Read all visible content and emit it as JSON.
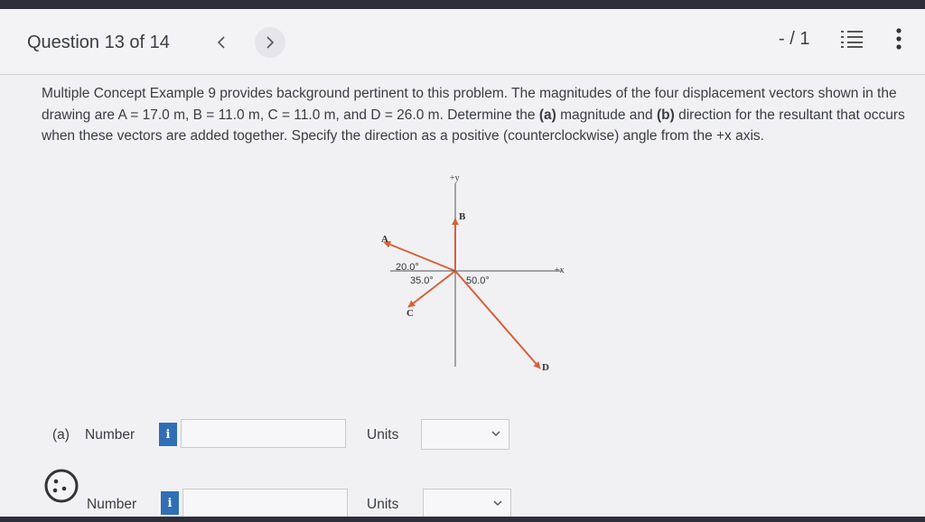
{
  "header": {
    "question_title": "Question 13 of 14",
    "prev_icon": "chevron-left-icon",
    "next_icon": "chevron-right-icon",
    "score": "- / 1",
    "list_icon": "list-icon",
    "more_icon": "more-vertical-icon"
  },
  "question": {
    "p1": "Multiple Concept Example 9 provides background pertinent to this problem. The magnitudes of the four displacement vectors shown in the drawing are ",
    "a_eq": "A = 17.0 m, B = 11.0 m, C = 11.0 m, and D = 26.0 m",
    "p2": ". Determine the ",
    "part_a": "(a)",
    "p3": " magnitude and ",
    "part_b": "(b)",
    "p4": " direction for the resultant that occurs when these vectors are added together. Specify the direction as a positive (counterclockwise) angle from the +x axis."
  },
  "figure": {
    "plus_y": "+y",
    "plus_x": "+x",
    "label_a": "A",
    "label_b": "B",
    "label_c": "C",
    "label_d": "D",
    "angle_a": "20.0°",
    "angle_c": "35.0°",
    "angle_d": "50.0°",
    "arrow_color": "#d9603b"
  },
  "answers": {
    "row_a_prefix": "(a)",
    "row_a_label": "Number",
    "row_b_label": "Number",
    "info": "i",
    "units_label": "Units",
    "info_color": "#2f6fb6"
  },
  "assistant_icon": "cookie-icon"
}
